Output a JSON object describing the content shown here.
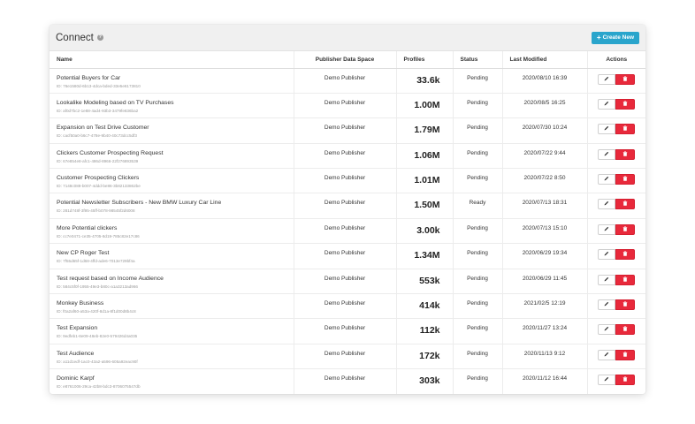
{
  "header": {
    "title": "Connect",
    "help_icon": "question-circle-icon",
    "create_label": "Create New",
    "create_icon": "plus-icon"
  },
  "columns": {
    "name": "Name",
    "publisher": "Publisher Data Space",
    "profiles": "Profiles",
    "status": "Status",
    "modified": "Last Modified",
    "actions": "Actions"
  },
  "colors": {
    "accent": "#2aa5cc",
    "danger": "#e8293b",
    "header_bg": "#f0f0f0"
  },
  "rows": [
    {
      "name": "Potential Buyers for Car",
      "id": "ID: 76e1580d-6b13-4dca-bded-33e5e6173810",
      "publisher": "Demo Publisher",
      "profiles": "33.6k",
      "status": "Pending",
      "modified": "2020/08/10 16:39"
    },
    {
      "name": "Lookalike Modeling based on TV Purchases",
      "id": "ID: af0d7bc2-1e88-4ad4-93b3-3479fe836ba2",
      "publisher": "Demo Publisher",
      "profiles": "1.00M",
      "status": "Pending",
      "modified": "2020/08/5 16:25"
    },
    {
      "name": "Expansion on Test Drive Customer",
      "id": "ID: cacf50a0-b6c7-478e-9b40-40c73dcc5df3",
      "publisher": "Demo Publisher",
      "profiles": "1.79M",
      "status": "Pending",
      "modified": "2020/07/30 10:24"
    },
    {
      "name": "Clickers Customer Prospecting Request",
      "id": "ID: 67e854e8-afc1-486d-8966-22f276893539",
      "publisher": "Demo Publisher",
      "profiles": "1.06M",
      "status": "Pending",
      "modified": "2020/07/22 9:44"
    },
    {
      "name": "Customer Prospecting Clickers",
      "id": "ID: 7148c089-b007-4ddd-be86-3b82133862be",
      "publisher": "Demo Publisher",
      "profiles": "1.01M",
      "status": "Pending",
      "modified": "2020/07/22 8:50"
    },
    {
      "name": "Potential Newsletter Subscribers - New BMW Luxury Car Line",
      "id": "ID: 281d748f-3f95-45ff-b078-98545f2d6008",
      "publisher": "Demo Publisher",
      "profiles": "1.50M",
      "status": "Ready",
      "modified": "2020/07/13 18:31"
    },
    {
      "name": "More Potential clickers",
      "id": "ID: cc7e0471-ce35-4705-8d19-785c82e17c86",
      "publisher": "Demo Publisher",
      "profiles": "3.00k",
      "status": "Pending",
      "modified": "2020/07/13 15:10"
    },
    {
      "name": "New CP Roger Test",
      "id": "ID: 7f55d65f-1d68-4ffd-ade6-7013e729bf4a",
      "publisher": "Demo Publisher",
      "profiles": "1.34M",
      "status": "Pending",
      "modified": "2020/06/29 19:34"
    },
    {
      "name": "Test request based on Income Audience",
      "id": "ID: 584c5f0f-1955-49e3-b80c-a1a3213ad966",
      "publisher": "Demo Publisher",
      "profiles": "553k",
      "status": "Pending",
      "modified": "2020/06/29 11:45"
    },
    {
      "name": "Monkey Business",
      "id": "ID: f0a2af60-a53a-420f-8d1a-8f1d00d8b4c8",
      "publisher": "Demo Publisher",
      "profiles": "414k",
      "status": "Pending",
      "modified": "2021/02/5 12:19"
    },
    {
      "name": "Test Expansion",
      "id": "ID: 9edfeb1-8e09-48eb-82e0-579426d4a035",
      "publisher": "Demo Publisher",
      "profiles": "112k",
      "status": "Pending",
      "modified": "2020/11/27 13:24"
    },
    {
      "name": "Test Audience",
      "id": "ID: a11d1edf-1ac0-43a2-a596-605a92eac90f",
      "publisher": "Demo Publisher",
      "profiles": "172k",
      "status": "Pending",
      "modified": "2020/11/13 9:12"
    },
    {
      "name": "Dominic Karpf",
      "id": "ID: e8761006-29ca-42b8-bdc3-8706075547db",
      "publisher": "Demo Publisher",
      "profiles": "303k",
      "status": "Pending",
      "modified": "2020/11/12 16:44"
    }
  ],
  "row_actions": {
    "edit_icon": "pencil-icon",
    "delete_icon": "trash-icon"
  }
}
